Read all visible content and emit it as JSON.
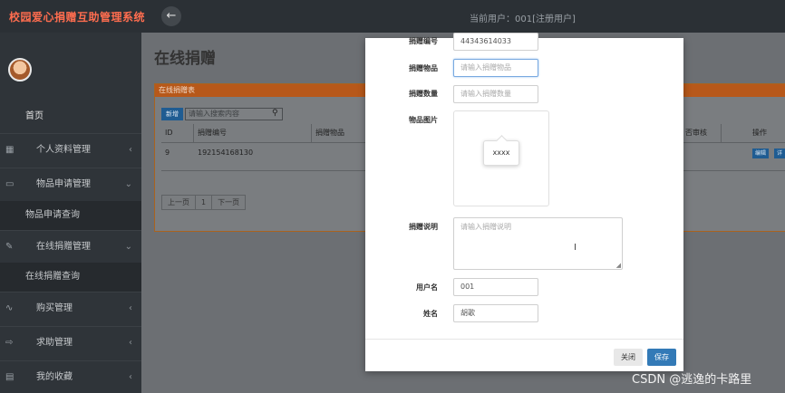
{
  "app": {
    "title": "校园爱心捐赠互助管理系统",
    "back_icon": "←",
    "current_user": "当前用户：001[注册用户]"
  },
  "sidebar": {
    "home": "首页",
    "items": [
      {
        "label": "个人资料管理",
        "icon": "▦",
        "chevron": "‹"
      },
      {
        "label": "物品申请管理",
        "icon": "▭",
        "chevron": "⌄"
      },
      {
        "label": "在线捐赠管理",
        "icon": "✎",
        "chevron": "⌄"
      },
      {
        "label": "购买管理",
        "icon": "∿",
        "chevron": "‹"
      },
      {
        "label": "求助管理",
        "icon": "⇨",
        "chevron": "‹"
      },
      {
        "label": "我的收藏",
        "icon": "▤",
        "chevron": "‹"
      }
    ],
    "subs": [
      "物品申请查询",
      "在线捐赠查询"
    ]
  },
  "main": {
    "page_title": "在线捐赠",
    "panel_title": "在线捐赠表",
    "add_label": "新增",
    "search_placeholder": "请输入搜索内容",
    "search_icon": "⚲",
    "columns": [
      "ID",
      "捐赠编号",
      "捐赠物品",
      "否审核",
      "操作"
    ],
    "row": {
      "id": "9",
      "code": "192154168130",
      "edit": "编辑",
      "detail": "详"
    },
    "pager": {
      "prev": "上一页",
      "page": "1",
      "next": "下一页"
    }
  },
  "modal": {
    "code_label": "捐赠编号",
    "code_value": "44343614033",
    "item_label": "捐赠物品",
    "item_placeholder": "请输入捐赠物品",
    "qty_label": "捐赠数量",
    "qty_placeholder": "请输入捐赠数量",
    "image_label": "物品图片",
    "image_tooltip": "xxxx",
    "desc_label": "捐赠说明",
    "desc_placeholder": "请输入捐赠说明",
    "user_label": "用户名",
    "user_value": "001",
    "name_label": "姓名",
    "name_value": "胡歌",
    "close_label": "关闭",
    "save_label": "保存",
    "cursor": "I",
    "resize": "◢"
  },
  "watermark": "CSDN @逃逸的卡路里",
  "colors": {
    "accent": "#337ab7",
    "brand": "#ff6d4f",
    "panel_head": "#b7581a"
  }
}
